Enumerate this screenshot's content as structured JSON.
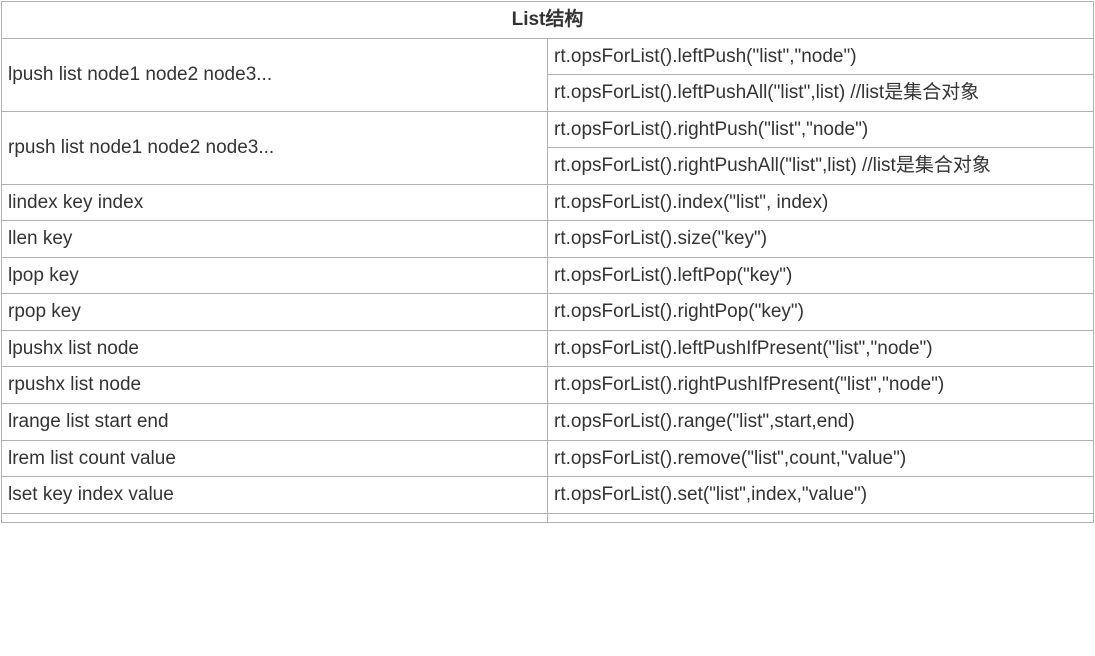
{
  "header": "List结构",
  "rows": [
    {
      "left": "lpush list node1 node2 node3...",
      "rights": [
        "rt.opsForList().leftPush(\"list\",\"node\")",
        "rt.opsForList().leftPushAll(\"list\",list) //list是集合对象"
      ]
    },
    {
      "left": "rpush list node1 node2 node3...",
      "rights": [
        "rt.opsForList().rightPush(\"list\",\"node\")",
        "rt.opsForList().rightPushAll(\"list\",list) //list是集合对象"
      ]
    },
    {
      "left": "lindex key index",
      "rights": [
        "rt.opsForList().index(\"list\", index)"
      ]
    },
    {
      "left": "llen key",
      "rights": [
        "rt.opsForList().size(\"key\")"
      ]
    },
    {
      "left": "lpop key",
      "rights": [
        "rt.opsForList().leftPop(\"key\")"
      ]
    },
    {
      "left": "rpop key",
      "rights": [
        "rt.opsForList().rightPop(\"key\")"
      ]
    },
    {
      "left": "lpushx list node",
      "rights": [
        "rt.opsForList().leftPushIfPresent(\"list\",\"node\")"
      ]
    },
    {
      "left": "rpushx list node",
      "rights": [
        "rt.opsForList().rightPushIfPresent(\"list\",\"node\")"
      ]
    },
    {
      "left": "lrange list start end",
      "rights": [
        "rt.opsForList().range(\"list\",start,end)"
      ]
    },
    {
      "left": "lrem list count value",
      "rights": [
        "rt.opsForList().remove(\"list\",count,\"value\")"
      ]
    },
    {
      "left": "lset key index value",
      "rights": [
        "rt.opsForList().set(\"list\",index,\"value\")"
      ]
    },
    {
      "left": "",
      "rights": [
        ""
      ]
    }
  ]
}
